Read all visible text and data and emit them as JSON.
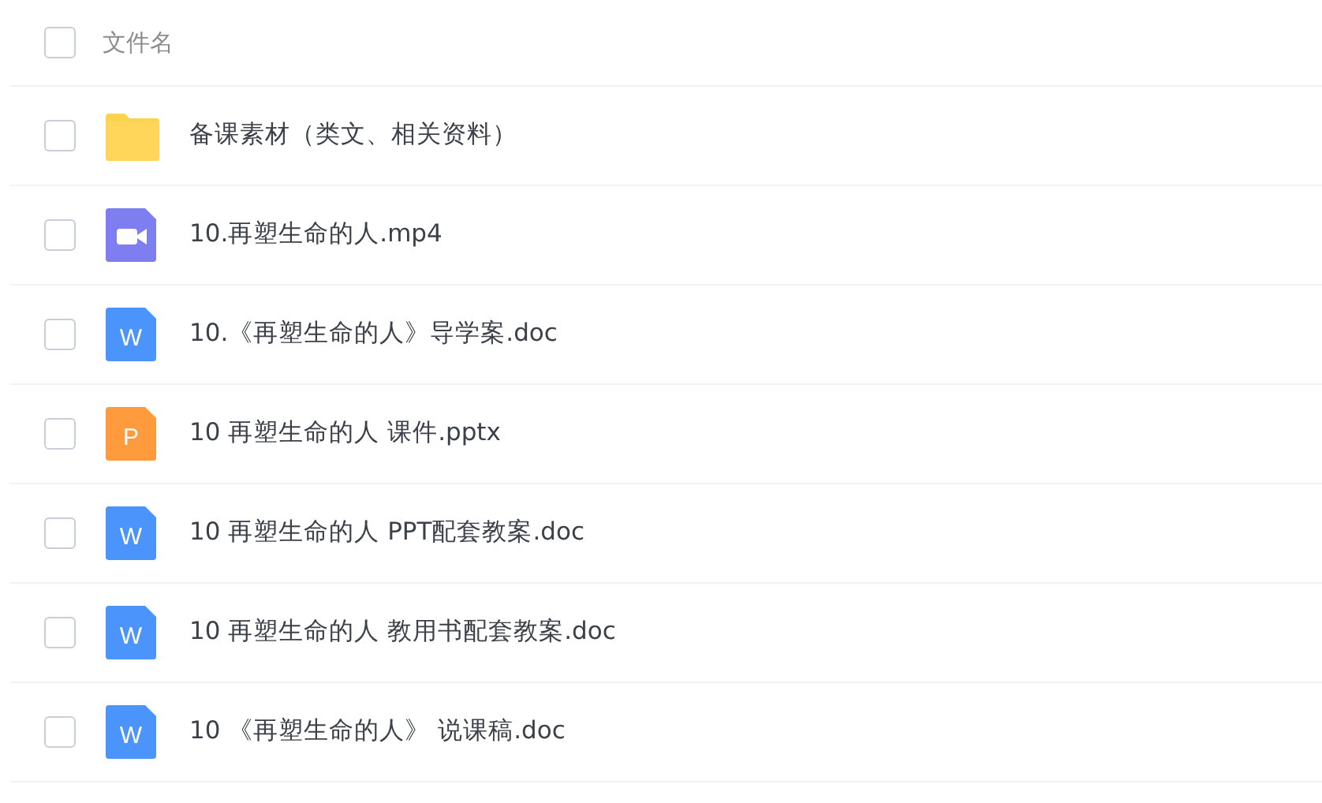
{
  "header": {
    "checked": false,
    "label": "文件名"
  },
  "files": [
    {
      "kind": "folder",
      "name": "备课素材（类文、相关资料）",
      "checked": false
    },
    {
      "kind": "video",
      "name": "10.再塑生命的人.mp4",
      "checked": false
    },
    {
      "kind": "word",
      "badge": "W",
      "name": "10.《再塑生命的人》导学案.doc",
      "checked": false
    },
    {
      "kind": "ppt",
      "badge": "P",
      "name": "10 再塑生命的人 课件.pptx",
      "checked": false
    },
    {
      "kind": "word",
      "badge": "W",
      "name": "10 再塑生命的人 PPT配套教案.doc",
      "checked": false
    },
    {
      "kind": "word",
      "badge": "W",
      "name": "10 再塑生命的人 教用书配套教案.doc",
      "checked": false
    },
    {
      "kind": "word",
      "badge": "W",
      "name": "10 《再塑生命的人》 说课稿.doc",
      "checked": false
    }
  ]
}
